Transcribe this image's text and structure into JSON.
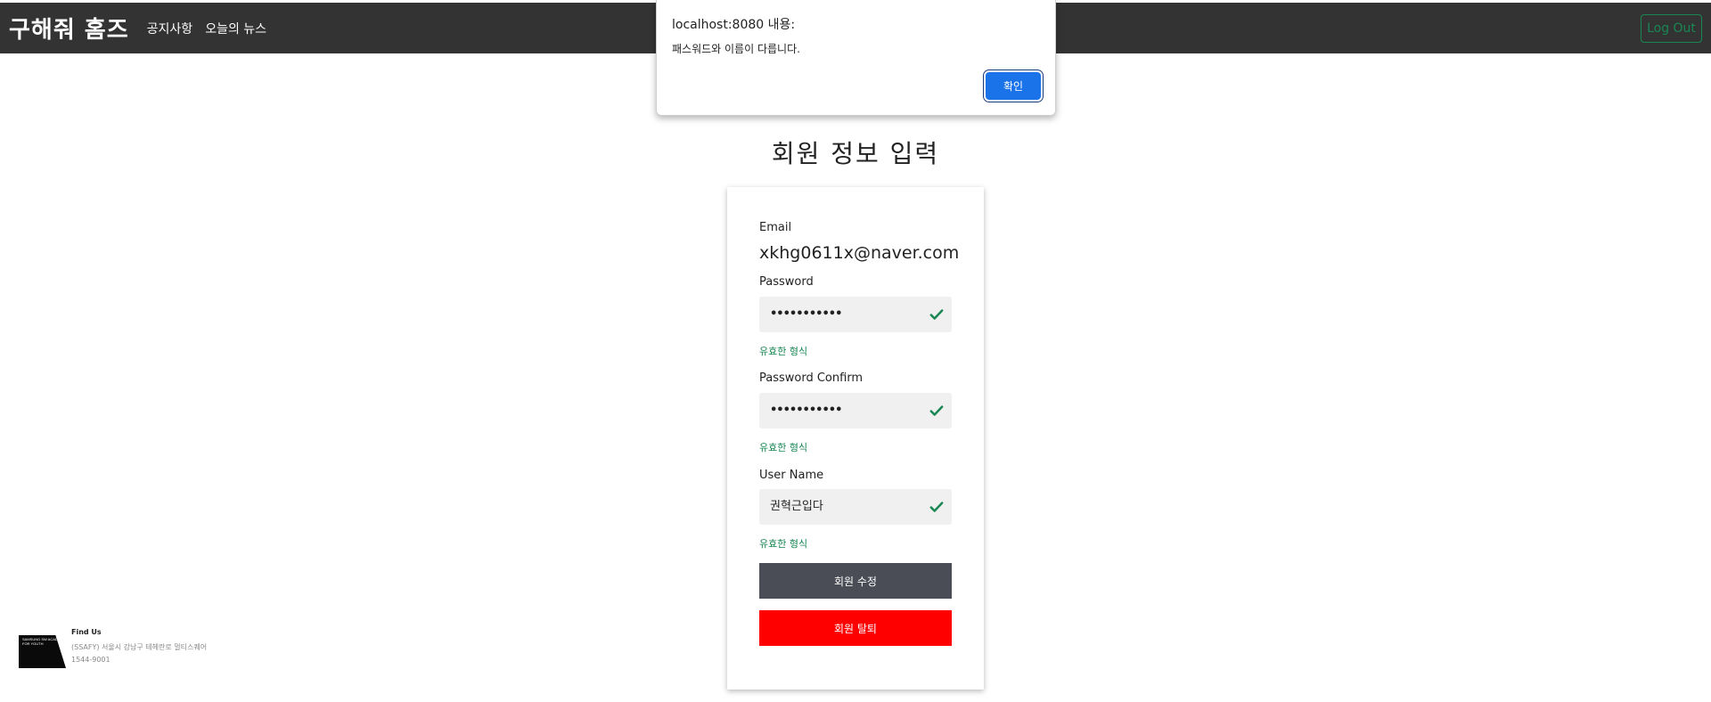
{
  "navbar": {
    "brand": "구해줘 홈즈",
    "links": [
      "공지사항",
      "오늘의 뉴스"
    ],
    "logout_label": "Log Out"
  },
  "page_title": "회원 정보 입력",
  "form": {
    "email_label": "Email",
    "email_value": "xkhg0611x@naver.com",
    "password_label": "Password",
    "password_value": "•••••••••••",
    "password_valid": "유효한 형식",
    "password_confirm_label": "Password Confirm",
    "password_confirm_value": "•••••••••••",
    "password_confirm_valid": "유효한 형식",
    "username_label": "User Name",
    "username_value": "권혁근입다",
    "username_valid": "유효한 형식",
    "edit_button": "회원 수정",
    "delete_button": "회원 탈퇴"
  },
  "footer": {
    "logo_text": "SAMSUNG SW ACADEMY FOR YOUTH",
    "title": "Find Us",
    "address": "(SSAFY) 서울시 강남구 테헤란로 멀티스퀘어",
    "phone": "1544-9001"
  },
  "dialog": {
    "title": "localhost:8080 내용:",
    "message": "패스워드와 이름이 다릅니다.",
    "ok_label": "확인"
  },
  "colors": {
    "navbar_bg": "#333333",
    "valid_green": "#198754",
    "edit_button": "#4a4d55",
    "delete_button": "#ff0000",
    "dialog_button": "#1a73e8"
  },
  "icons": {
    "field_status": "check-icon"
  }
}
